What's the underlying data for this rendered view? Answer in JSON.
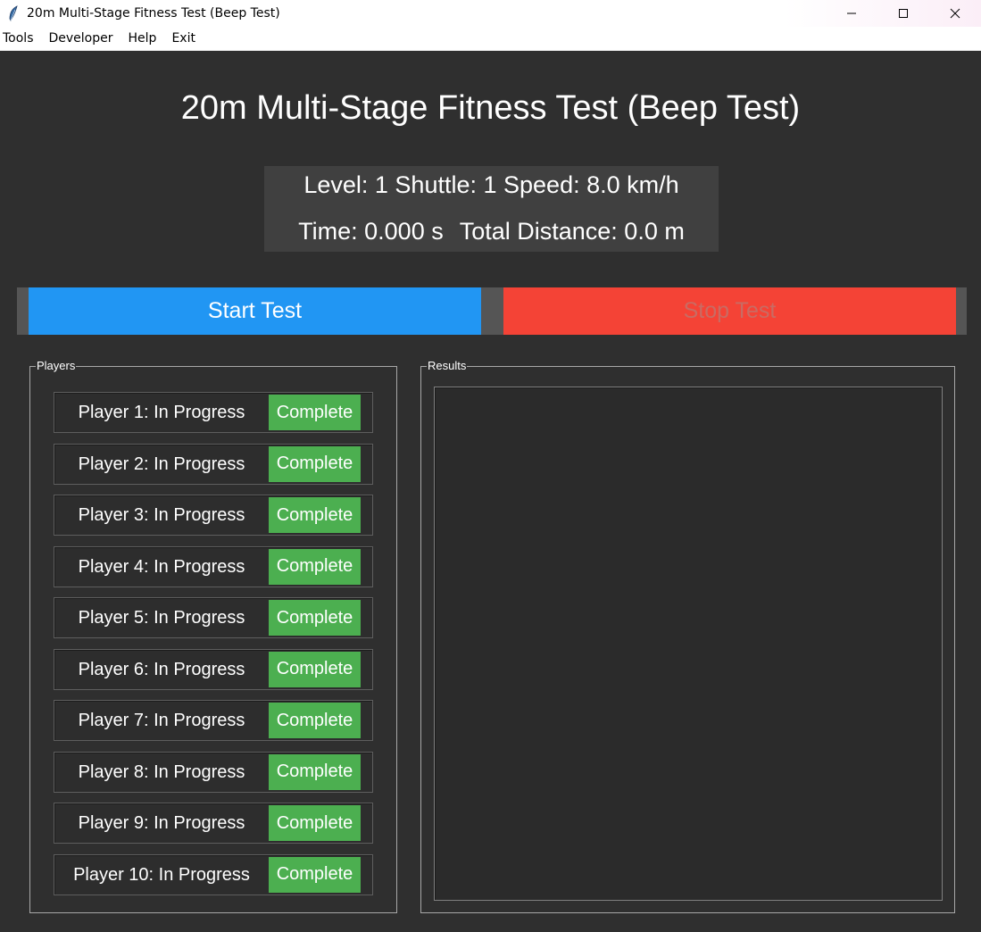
{
  "window": {
    "title": "20m Multi-Stage Fitness Test (Beep Test)"
  },
  "menu": [
    "Tools",
    "Developer",
    "Help",
    "Exit"
  ],
  "heading": "20m Multi-Stage Fitness Test (Beep Test)",
  "status": {
    "line1": "Level: 1 Shuttle: 1 Speed: 8.0 km/h",
    "time": "Time: 0.000 s",
    "distance": "Total Distance: 0.0 m"
  },
  "controls": {
    "start_label": "Start Test",
    "stop_label": "Stop Test"
  },
  "colors": {
    "start": "#2196f3",
    "stop": "#f44336",
    "complete": "#4caf50",
    "background": "#2f2f2f"
  },
  "players": {
    "frame_label": "Players",
    "complete_label": "Complete",
    "rows": [
      "Player 1: In Progress",
      "Player 2: In Progress",
      "Player 3: In Progress",
      "Player 4: In Progress",
      "Player 5: In Progress",
      "Player 6: In Progress",
      "Player 7: In Progress",
      "Player 8: In Progress",
      "Player 9: In Progress",
      "Player 10: In Progress"
    ]
  },
  "results": {
    "frame_label": "Results",
    "content": ""
  }
}
